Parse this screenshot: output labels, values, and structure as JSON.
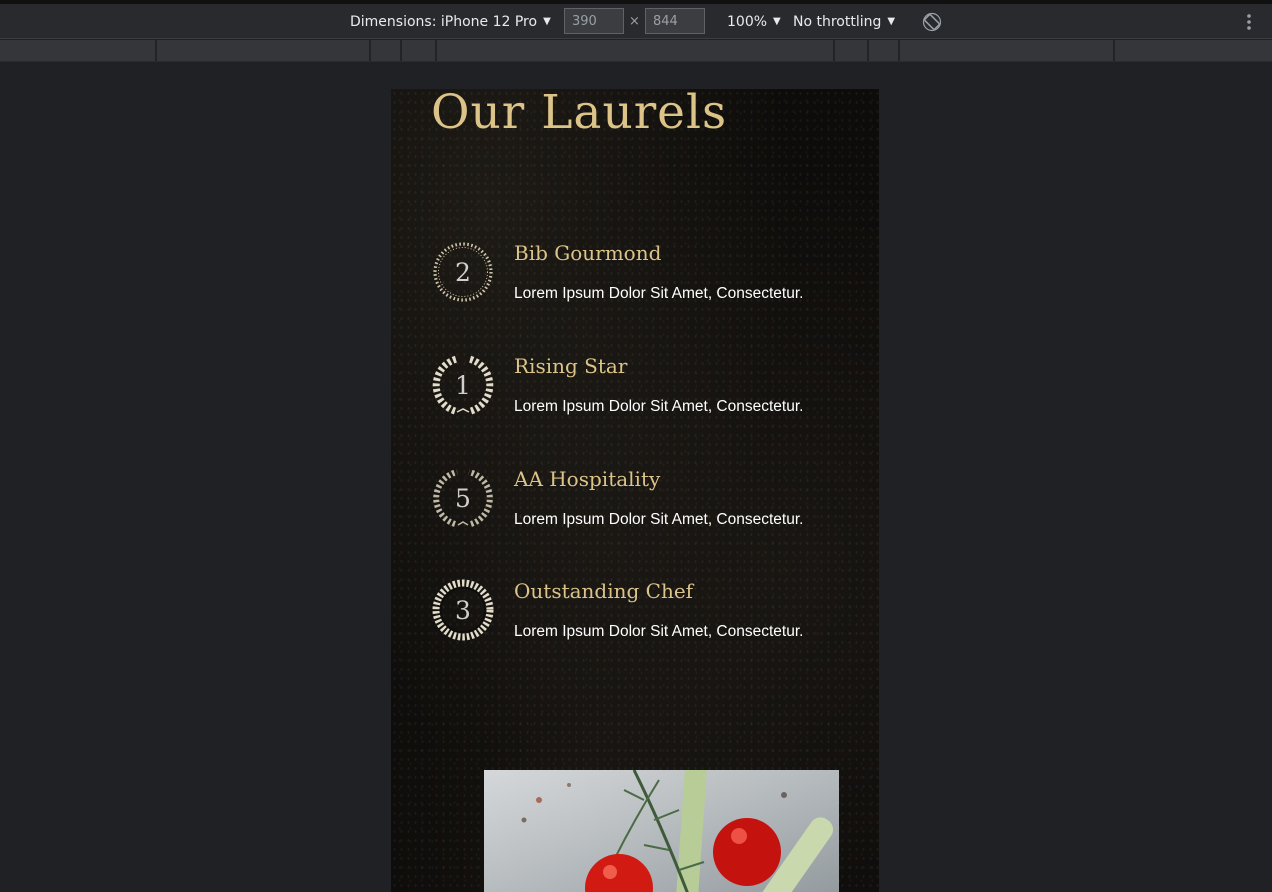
{
  "devtools": {
    "dimensions_label": "Dimensions: iPhone 12 Pro",
    "width_value": "390",
    "height_value": "844",
    "times_symbol": "×",
    "zoom": "100%",
    "throttling": "No throttling",
    "caret": "▼",
    "icons": [
      "rotate-icon",
      "more-options-icon"
    ]
  },
  "page": {
    "title": "Our Laurels",
    "laurels": [
      {
        "number": "2",
        "title": "Bib Gourmond",
        "desc": "Lorem Ipsum Dolor Sit Amet, Consectetur."
      },
      {
        "number": "1",
        "title": "Rising Star",
        "desc": "Lorem Ipsum Dolor Sit Amet, Consectetur."
      },
      {
        "number": "5",
        "title": "AA Hospitality",
        "desc": "Lorem Ipsum Dolor Sit Amet, Consectetur."
      },
      {
        "number": "3",
        "title": "Outstanding Chef",
        "desc": "Lorem Ipsum Dolor Sit Amet, Consectetur."
      }
    ],
    "colors": {
      "gold": "#dcc489",
      "background": "#0e0c0a",
      "text": "#ffffff"
    }
  }
}
